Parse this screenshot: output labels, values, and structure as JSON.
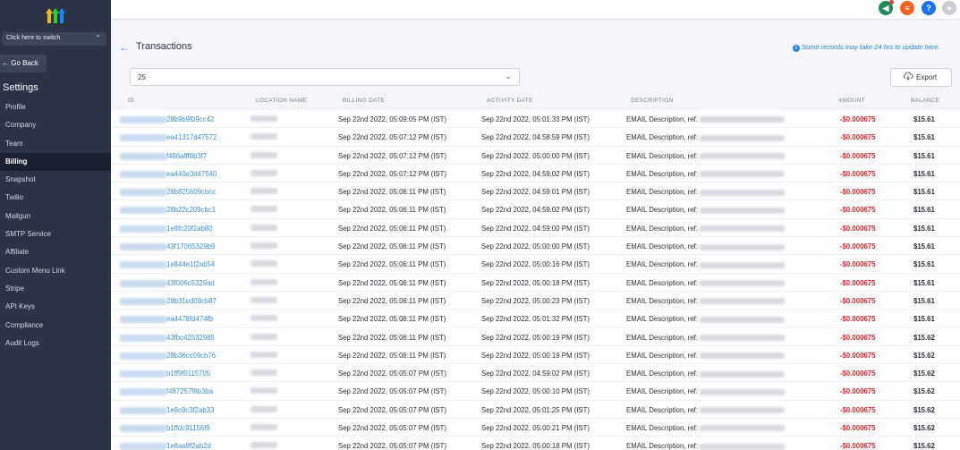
{
  "sidebar": {
    "switcher_label": "Click here to switch",
    "go_back_label": "Go Back",
    "settings_title": "Settings",
    "items": [
      {
        "label": "Profile",
        "active": false
      },
      {
        "label": "Company",
        "active": false
      },
      {
        "label": "Team",
        "active": false
      },
      {
        "label": "Billing",
        "active": true
      },
      {
        "label": "Snapshot",
        "active": false
      },
      {
        "label": "Twilio",
        "active": false
      },
      {
        "label": "Mailgun",
        "active": false
      },
      {
        "label": "SMTP Service",
        "active": false
      },
      {
        "label": "Affiliate",
        "active": false
      },
      {
        "label": "Custom Menu Link",
        "active": false
      },
      {
        "label": "Stripe",
        "active": false
      },
      {
        "label": "API Keys",
        "active": false
      },
      {
        "label": "Compliance",
        "active": false
      },
      {
        "label": "Audit Logs",
        "active": false
      }
    ]
  },
  "topbar": {
    "icons": [
      "megaphone-icon",
      "list-icon",
      "help-icon",
      "user-avatar-icon"
    ]
  },
  "header": {
    "title": "Transactions",
    "notice": "Some records may take 24 hrs to update here."
  },
  "controls": {
    "per_page_value": "25",
    "export_label": "Export"
  },
  "table": {
    "columns": [
      "ID",
      "LOCATION NAME",
      "BILLING DATE",
      "ACTIVITY DATE",
      "DESCRIPTION",
      "AMOUNT",
      "BALANCE"
    ],
    "rows": [
      {
        "id": "28b9b9f09cc42",
        "billing": "Sep 22nd 2022, 05:09:05 PM (IST)",
        "activity": "Sep 22nd 2022, 05:01:33 PM (IST)",
        "desc": "EMAIL Description, ref:",
        "amount": "-$0.000675",
        "balance": "$15.61"
      },
      {
        "id": "ea41317d47572",
        "billing": "Sep 22nd 2022, 05:07:12 PM (IST)",
        "activity": "Sep 22nd 2022, 04:58:59 PM (IST)",
        "desc": "EMAIL Description, ref:",
        "amount": "-$0.000675",
        "balance": "$15.61"
      },
      {
        "id": "f486afff8b3f7",
        "billing": "Sep 22nd 2022, 05:07:12 PM (IST)",
        "activity": "Sep 22nd 2022, 05:00:00 PM (IST)",
        "desc": "EMAIL Description, ref:",
        "amount": "-$0.000675",
        "balance": "$15.61"
      },
      {
        "id": "ea440e3d47540",
        "billing": "Sep 22nd 2022, 05:07:12 PM (IST)",
        "activity": "Sep 22nd 2022, 04:59:02 PM (IST)",
        "desc": "EMAIL Description, ref:",
        "amount": "-$0.000675",
        "balance": "$15.61"
      },
      {
        "id": "28b825609cbcc",
        "billing": "Sep 22nd 2022, 05:06:11 PM (IST)",
        "activity": "Sep 22nd 2022, 04:59:01 PM (IST)",
        "desc": "EMAIL Description, ref:",
        "amount": "-$0.000675",
        "balance": "$15.61"
      },
      {
        "id": "28b22c209cbc1",
        "billing": "Sep 22nd 2022, 05:06:11 PM (IST)",
        "activity": "Sep 22nd 2022, 04:59:02 PM (IST)",
        "desc": "EMAIL Description, ref:",
        "amount": "-$0.000675",
        "balance": "$15.61"
      },
      {
        "id": "1e8fc20f2ab80",
        "billing": "Sep 22nd 2022, 05:06:11 PM (IST)",
        "activity": "Sep 22nd 2022, 04:59:00 PM (IST)",
        "desc": "EMAIL Description, ref:",
        "amount": "-$0.000675",
        "balance": "$15.61"
      },
      {
        "id": "43f17065329b9",
        "billing": "Sep 22nd 2022, 05:06:11 PM (IST)",
        "activity": "Sep 22nd 2022, 05:00:00 PM (IST)",
        "desc": "EMAIL Description, ref:",
        "amount": "-$0.000675",
        "balance": "$15.61"
      },
      {
        "id": "1e844e1f2ab54",
        "billing": "Sep 22nd 2022, 05:06:11 PM (IST)",
        "activity": "Sep 22nd 2022, 05:00:16 PM (IST)",
        "desc": "EMAIL Description, ref:",
        "amount": "-$0.000675",
        "balance": "$15.61"
      },
      {
        "id": "43f006c5329ad",
        "billing": "Sep 22nd 2022, 05:06:11 PM (IST)",
        "activity": "Sep 22nd 2022, 05:00:18 PM (IST)",
        "desc": "EMAIL Description, ref:",
        "amount": "-$0.000675",
        "balance": "$15.61"
      },
      {
        "id": "28b31ed09cb87",
        "billing": "Sep 22nd 2022, 05:06:11 PM (IST)",
        "activity": "Sep 22nd 2022, 05:00:23 PM (IST)",
        "desc": "EMAIL Description, ref:",
        "amount": "-$0.000675",
        "balance": "$15.61"
      },
      {
        "id": "ea4478fd474fb",
        "billing": "Sep 22nd 2022, 05:06:11 PM (IST)",
        "activity": "Sep 22nd 2022, 05:01:32 PM (IST)",
        "desc": "EMAIL Description, ref:",
        "amount": "-$0.000675",
        "balance": "$15.61"
      },
      {
        "id": "43fbc42532985",
        "billing": "Sep 22nd 2022, 05:06:11 PM (IST)",
        "activity": "Sep 22nd 2022, 05:00:19 PM (IST)",
        "desc": "EMAIL Description, ref:",
        "amount": "-$0.000675",
        "balance": "$15.62"
      },
      {
        "id": "28b36cc09cb76",
        "billing": "Sep 22nd 2022, 05:06:11 PM (IST)",
        "activity": "Sep 22nd 2022, 05:00:19 PM (IST)",
        "desc": "EMAIL Description, ref:",
        "amount": "-$0.000675",
        "balance": "$15.62"
      },
      {
        "id": "b1ff9f0115705",
        "billing": "Sep 22nd 2022, 05:05:07 PM (IST)",
        "activity": "Sep 22nd 2022, 04:59:02 PM (IST)",
        "desc": "EMAIL Description, ref:",
        "amount": "-$0.000675",
        "balance": "$15.62"
      },
      {
        "id": "f487257f8b3ba",
        "billing": "Sep 22nd 2022, 05:05:07 PM (IST)",
        "activity": "Sep 22nd 2022, 05:00:10 PM (IST)",
        "desc": "EMAIL Description, ref:",
        "amount": "-$0.000675",
        "balance": "$15.62"
      },
      {
        "id": "1e8c8c3f2ab33",
        "billing": "Sep 22nd 2022, 05:05:07 PM (IST)",
        "activity": "Sep 22nd 2022, 05:01:25 PM (IST)",
        "desc": "EMAIL Description, ref:",
        "amount": "-$0.000675",
        "balance": "$15.62"
      },
      {
        "id": "b1ffdc91156f9",
        "billing": "Sep 22nd 2022, 05:05:07 PM (IST)",
        "activity": "Sep 22nd 2022, 05:00:21 PM (IST)",
        "desc": "EMAIL Description, ref:",
        "amount": "-$0.000675",
        "balance": "$15.62"
      },
      {
        "id": "1e8aa9f2ab2d",
        "billing": "Sep 22nd 2022, 05:05:07 PM (IST)",
        "activity": "Sep 22nd 2022, 05:00:18 PM (IST)",
        "desc": "EMAIL Description, ref:",
        "amount": "-$0.000675",
        "balance": "$15.62"
      }
    ]
  },
  "colors": {
    "sidebar_bg": "#2b3344",
    "link_blue": "#3b8fd9",
    "amount_red": "#e0262d"
  }
}
